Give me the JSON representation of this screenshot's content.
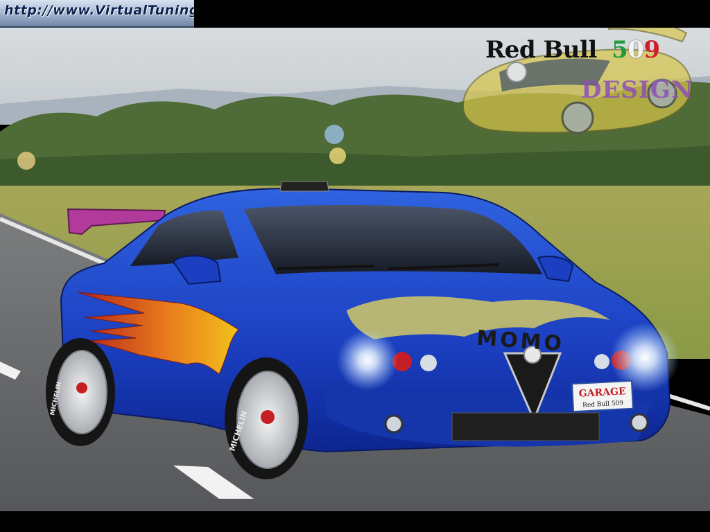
{
  "watermark": {
    "text": "http://www.VirtualTuning.IT"
  },
  "logo": {
    "title": "Red Bull",
    "number_digits": [
      "5",
      "0",
      "9"
    ],
    "subtitle": "DESIGN"
  },
  "car": {
    "hood_decal": "MOMO",
    "plate_line1": "GARAGE",
    "plate_line2": "Red Bull 509",
    "tire_brand": "MICHELIN",
    "body_color": "#1b3fc0",
    "spoiler_color": "#b13a9a"
  }
}
